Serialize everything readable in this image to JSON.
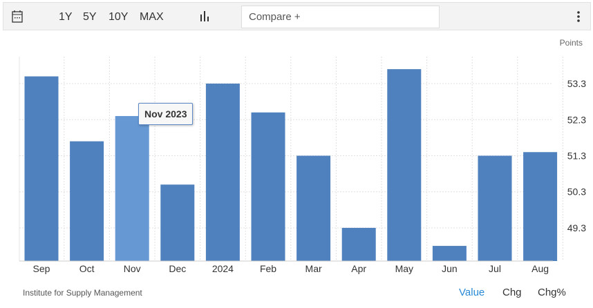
{
  "toolbar": {
    "ranges": [
      "1Y",
      "5Y",
      "10Y",
      "MAX"
    ],
    "compare_placeholder": "Compare +"
  },
  "footer": {
    "source": "Institute for Supply Management",
    "tabs": [
      "Value",
      "Chg",
      "Chg%"
    ],
    "active_tab": "Value"
  },
  "tooltip": {
    "label": "Nov 2023"
  },
  "colors": {
    "bar": "#4e81bd",
    "bar_highlight": "#6699d4",
    "active_tab": "#2a8ad6"
  },
  "chart_data": {
    "type": "bar",
    "unit_label": "Points",
    "categories": [
      "Sep",
      "Oct",
      "Nov",
      "Dec",
      "2024",
      "Feb",
      "Mar",
      "Apr",
      "May",
      "Jun",
      "Jul",
      "Aug"
    ],
    "values": [
      53.5,
      51.7,
      52.4,
      50.5,
      53.3,
      52.5,
      51.3,
      49.3,
      53.7,
      48.8,
      51.3,
      51.4
    ],
    "highlighted": "Nov",
    "yticks": [
      49.3,
      50.3,
      51.3,
      52.3,
      53.3
    ],
    "ylim": [
      48.38,
      54.5
    ],
    "grid": true
  }
}
